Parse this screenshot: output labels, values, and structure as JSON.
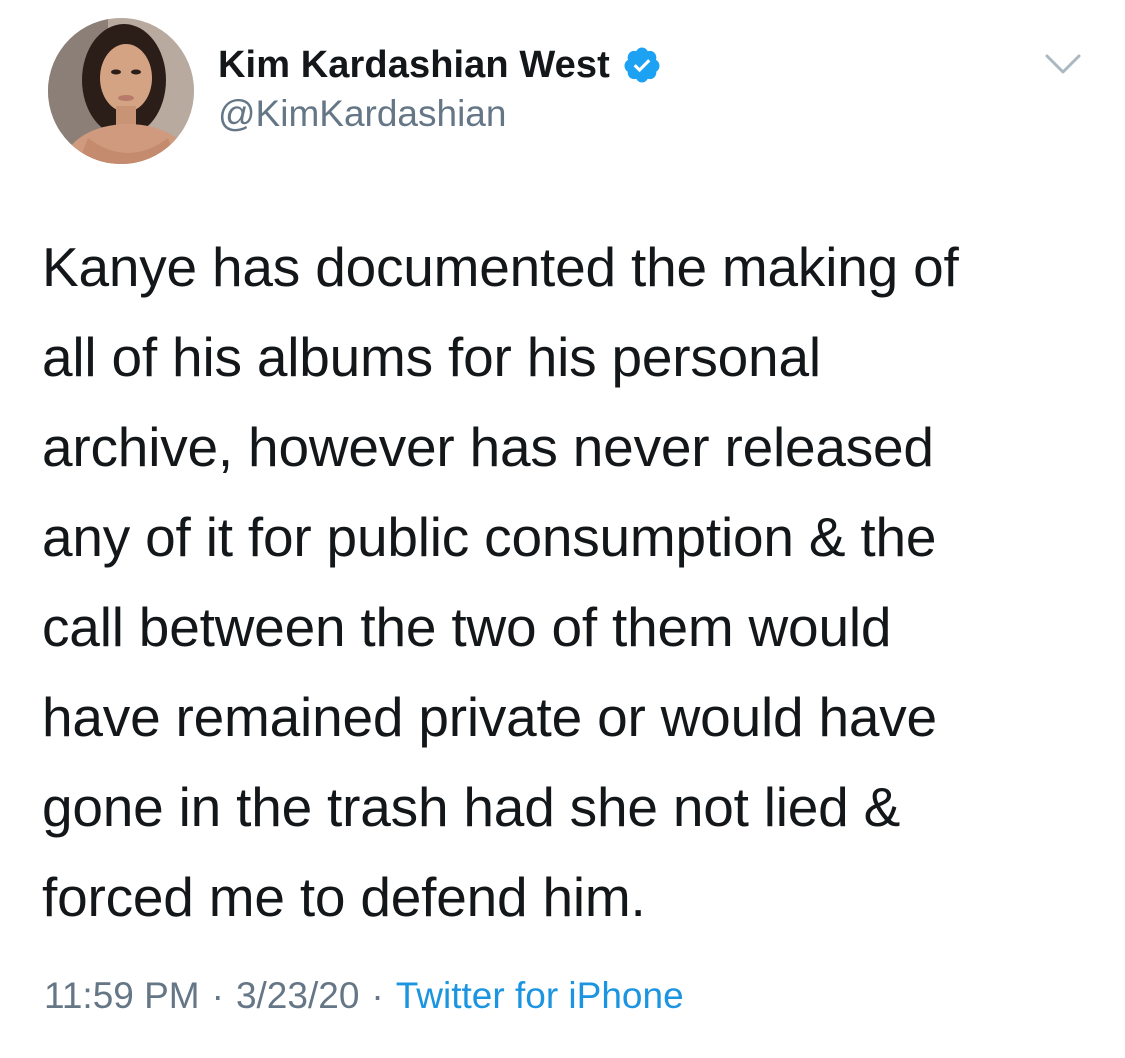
{
  "author": {
    "display_name": "Kim Kardashian West",
    "handle": "@KimKardashian",
    "verified": true,
    "avatar_icon": "profile-photo"
  },
  "menu": {
    "icon": "chevron-down-icon"
  },
  "tweet": {
    "text_lines": [
      "Kanye has documented the making of",
      "all of his albums for his personal",
      "archive, however has never released",
      "any of it for public consumption & the",
      "call between the two of them would",
      "have remained private or would have",
      "gone in the trash had she not lied &",
      "forced me to defend him."
    ]
  },
  "meta": {
    "time": "11:59 PM",
    "separator": "·",
    "date": "3/23/20",
    "source": "Twitter for iPhone"
  },
  "colors": {
    "text": "#14171a",
    "secondary": "#657786",
    "link": "#1b95e0",
    "verified": "#1da1f2",
    "background": "#ffffff"
  }
}
